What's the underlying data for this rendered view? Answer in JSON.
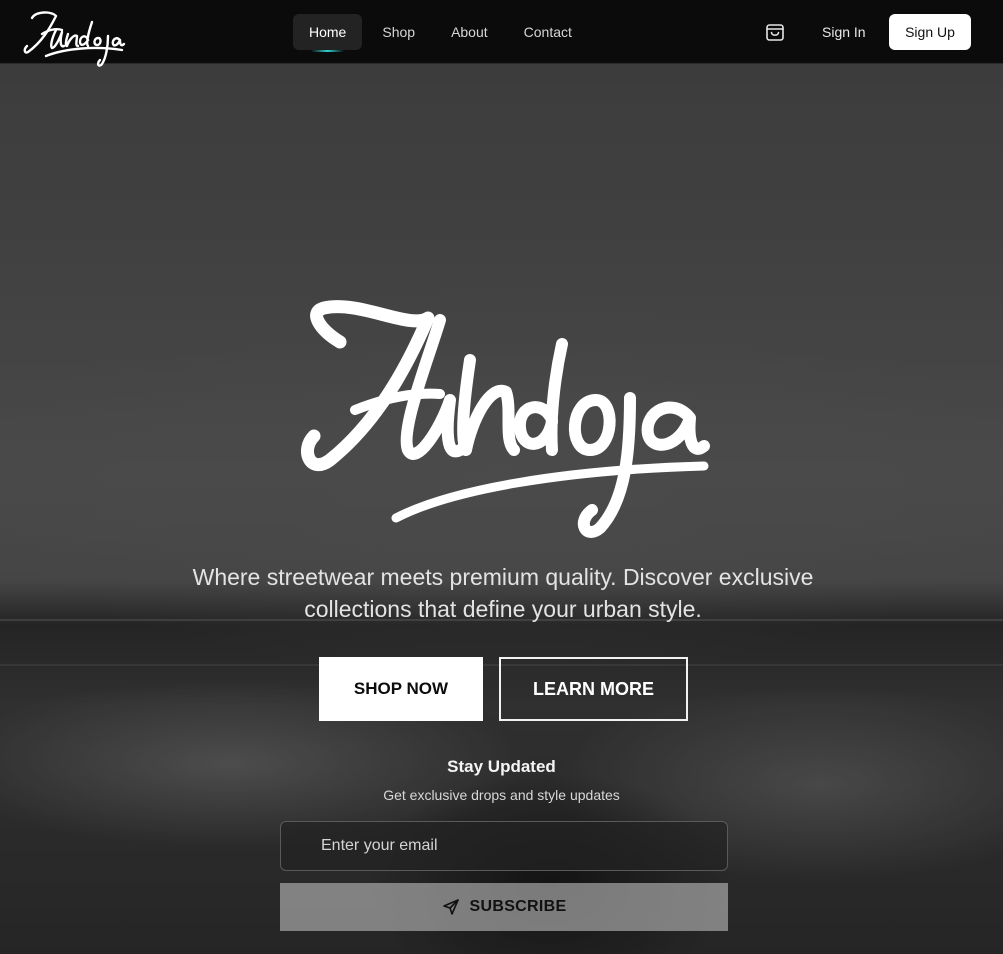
{
  "brand": {
    "logo_text": "Hundoja"
  },
  "nav": {
    "links": [
      {
        "label": "Home",
        "active": true
      },
      {
        "label": "Shop",
        "active": false
      },
      {
        "label": "About",
        "active": false
      },
      {
        "label": "Contact",
        "active": false
      }
    ],
    "cart_icon": "shopping-bag-icon",
    "sign_in_label": "Sign In",
    "sign_up_label": "Sign Up"
  },
  "hero": {
    "logo_text": "Hundoja",
    "tagline_line1": "Where streetwear meets premium quality. Discover exclusive",
    "tagline_line2": "collections that define your urban style.",
    "primary_cta": "SHOP NOW",
    "secondary_cta": "LEARN MORE"
  },
  "newsletter": {
    "title": "Stay Updated",
    "subtitle": "Get exclusive drops and style updates",
    "email_placeholder": "Enter your email",
    "email_value": "",
    "subscribe_label": "SUBSCRIBE",
    "subscribe_icon": "send-icon"
  },
  "colors": {
    "navbar_bg": "#0b0b0b",
    "active_tab_bg": "#232323",
    "active_accent": "#2fd2d2",
    "primary_button_bg": "#ffffff",
    "subscribe_bg": "#b9b9b9"
  }
}
